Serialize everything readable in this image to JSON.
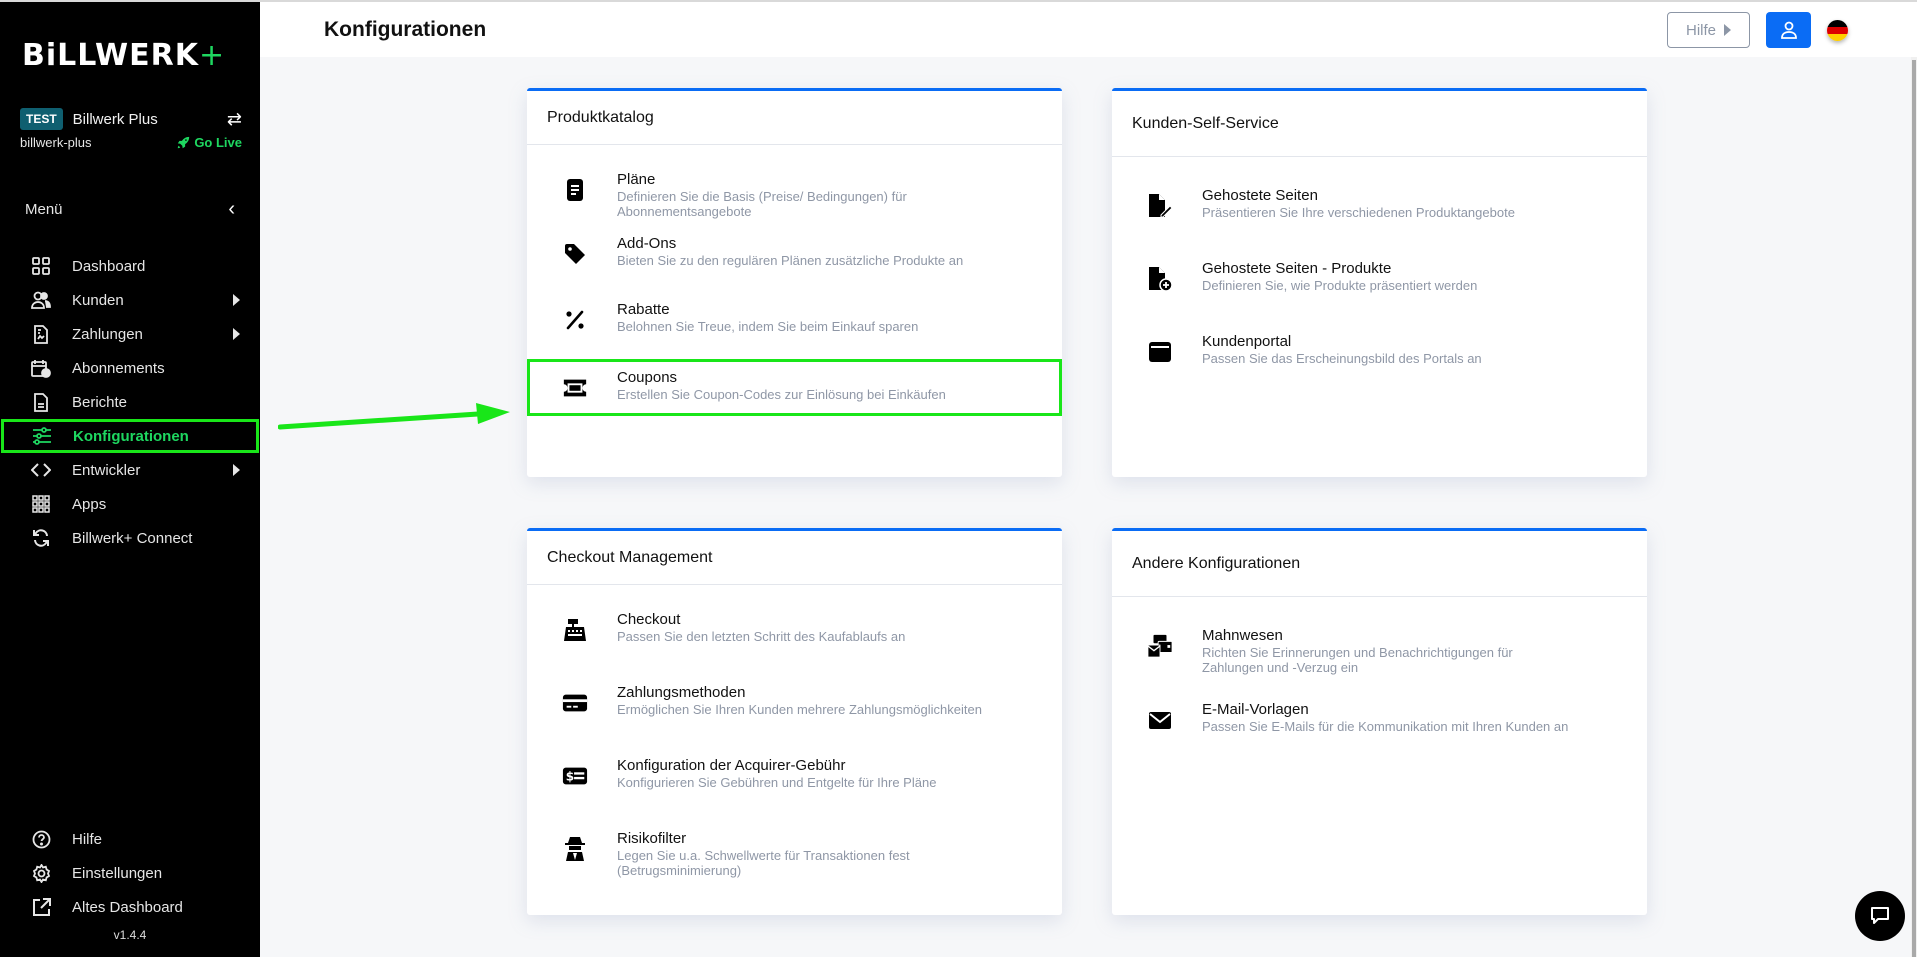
{
  "app": {
    "logo_text": "BiLLWERK",
    "logo_plus": "+",
    "version": "v1.4.4"
  },
  "account": {
    "badge": "TEST",
    "name": "Billwerk Plus",
    "slug": "billwerk-plus",
    "go_live": "Go Live",
    "switch_icon": "arrows-exchange-icon"
  },
  "sidebar": {
    "menu_label": "Menü",
    "items": [
      {
        "label": "Dashboard",
        "icon": "grid-icon",
        "submenu": false
      },
      {
        "label": "Kunden",
        "icon": "users-icon",
        "submenu": true
      },
      {
        "label": "Zahlungen",
        "icon": "invoice-icon",
        "submenu": true
      },
      {
        "label": "Abonnements",
        "icon": "calendar-clock-icon",
        "submenu": false
      },
      {
        "label": "Berichte",
        "icon": "report-icon",
        "submenu": false
      },
      {
        "label": "Konfigurationen",
        "icon": "sliders-icon",
        "submenu": false,
        "active": true
      },
      {
        "label": "Entwickler",
        "icon": "code-icon",
        "submenu": true
      },
      {
        "label": "Apps",
        "icon": "apps-grid-icon",
        "submenu": false
      },
      {
        "label": "Billwerk+ Connect",
        "icon": "sync-icon",
        "submenu": false
      }
    ],
    "bottom_items": [
      {
        "label": "Hilfe",
        "icon": "help-circle-icon"
      },
      {
        "label": "Einstellungen",
        "icon": "gear-icon"
      },
      {
        "label": "Altes Dashboard",
        "icon": "external-link-icon"
      }
    ]
  },
  "header": {
    "title": "Konfigurationen",
    "help_label": "Hilfe",
    "user_icon": "user-icon",
    "language_flag": "de-flag"
  },
  "cards": [
    {
      "title": "Produktkatalog",
      "items": [
        {
          "title": "Pläne",
          "description": "Definieren Sie die Basis (Preise/ Bedingungen) für Abonnementsangebote",
          "icon": "document-icon"
        },
        {
          "title": "Add-Ons",
          "description": "Bieten Sie zu den regulären Plänen zusätzliche Produkte an",
          "icon": "tag-icon"
        },
        {
          "title": "Rabatte",
          "description": "Belohnen Sie Treue, indem Sie beim Einkauf sparen",
          "icon": "percent-icon"
        },
        {
          "title": "Coupons",
          "description": "Erstellen Sie Coupon-Codes zur Einlösung bei Einkäufen",
          "icon": "ticket-icon",
          "highlighted": true
        }
      ]
    },
    {
      "title": "Kunden-Self-Service",
      "items": [
        {
          "title": "Gehostete Seiten",
          "description": "Präsentieren Sie Ihre verschiedenen Produktangebote",
          "icon": "file-pen-icon"
        },
        {
          "title": "Gehostete Seiten - Produkte",
          "description": "Definieren Sie, wie Produkte präsentiert werden",
          "icon": "file-plus-icon"
        },
        {
          "title": "Kundenportal",
          "description": "Passen Sie das Erscheinungsbild des Portals an",
          "icon": "window-icon"
        }
      ]
    },
    {
      "title": "Checkout Management",
      "items": [
        {
          "title": "Checkout",
          "description": "Passen Sie den letzten Schritt des Kaufablaufs an",
          "icon": "cash-register-icon"
        },
        {
          "title": "Zahlungsmethoden",
          "description": "Ermöglichen Sie Ihren Kunden mehrere Zahlungsmöglichkeiten",
          "icon": "credit-card-icon"
        },
        {
          "title": "Konfiguration der Acquirer-Gebühr",
          "description": "Konfigurieren Sie Gebühren und Entgelte für Ihre Pläne",
          "icon": "money-check-icon"
        },
        {
          "title": "Risikofilter",
          "description": "Legen Sie u.a. Schwellwerte für Transaktionen fest (Betrugsminimierung)",
          "icon": "spy-icon"
        }
      ]
    },
    {
      "title": "Andere Konfigurationen",
      "items": [
        {
          "title": "Mahnwesen",
          "description": "Richten Sie Erinnerungen und Benachrichtigungen für Zahlungen und -Verzug ein",
          "icon": "envelopes-icon"
        },
        {
          "title": "E-Mail-Vorlagen",
          "description": "Passen Sie E-Mails für die Kommunikation mit Ihren Kunden an",
          "icon": "envelope-icon"
        }
      ]
    }
  ],
  "colors": {
    "accent": "#0a6cf5",
    "highlight": "#19e619",
    "go_live": "#1ed760",
    "badge": "#0f5f70",
    "sidebar_bg": "#000000"
  }
}
